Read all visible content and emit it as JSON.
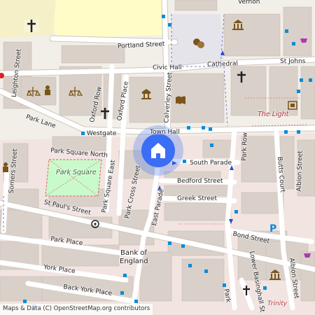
{
  "map": {
    "streets": [
      {
        "id": "portland-street",
        "label": "Portland Street"
      },
      {
        "id": "civic-hall",
        "label": "Civic Hall"
      },
      {
        "id": "cathedral",
        "label": "Cathedral"
      },
      {
        "id": "st-johns",
        "label": "St Johns"
      },
      {
        "id": "vernon",
        "label": "Vernon"
      },
      {
        "id": "leighton-street",
        "label": "Leighton Street"
      },
      {
        "id": "oxford-row",
        "label": "Oxford Row"
      },
      {
        "id": "oxford-place",
        "label": "Oxford Place"
      },
      {
        "id": "calverley-street",
        "label": "Calverley Street"
      },
      {
        "id": "park-lane",
        "label": "Park Lane"
      },
      {
        "id": "westgate",
        "label": "Westgate"
      },
      {
        "id": "town-hall",
        "label": "Town Hall"
      },
      {
        "id": "park-square-north",
        "label": "Park Square North"
      },
      {
        "id": "park-square-east",
        "label": "Park Square East"
      },
      {
        "id": "somers-street",
        "label": "Somers Street"
      },
      {
        "id": "south-parade",
        "label": "South Parade"
      },
      {
        "id": "park-row",
        "label": "Park Row"
      },
      {
        "id": "butts-court",
        "label": "Butts Court"
      },
      {
        "id": "albion-street-north",
        "label": "Albion Street"
      },
      {
        "id": "bedford-street",
        "label": "Bedford Street"
      },
      {
        "id": "greek-street",
        "label": "Greek Street"
      },
      {
        "id": "park-cross-street",
        "label": "Park Cross Street"
      },
      {
        "id": "east-parade",
        "label": "East Parade"
      },
      {
        "id": "st-pauls-street",
        "label": "St Paul's Street"
      },
      {
        "id": "park-place",
        "label": "Park Place"
      },
      {
        "id": "bond-street",
        "label": "Bond Street"
      },
      {
        "id": "york-place",
        "label": "York Place"
      },
      {
        "id": "back-york-place",
        "label": "Back York Place"
      },
      {
        "id": "lower-basinghall",
        "label": "Lower Basinghall St"
      },
      {
        "id": "albion-street-south",
        "label": "Albion Street"
      },
      {
        "id": "park-short",
        "label": "Park"
      },
      {
        "id": "trinity",
        "label": "Trinity"
      }
    ],
    "park_label": "Park Square",
    "poi_label": "The Light",
    "bank_label_line1": "Bank of",
    "bank_label_line2": "England",
    "attribution": "Maps & Data (C) OpenStreetMap.org contributors",
    "marker": {
      "icon": "home-icon"
    },
    "colors": {
      "background": "#f2efe9",
      "building": "#d9d0c9",
      "road": "#ffffff",
      "park": "#c8facc",
      "marker": "#3b6ef5",
      "bus_stop": "#0a8cd8"
    }
  }
}
